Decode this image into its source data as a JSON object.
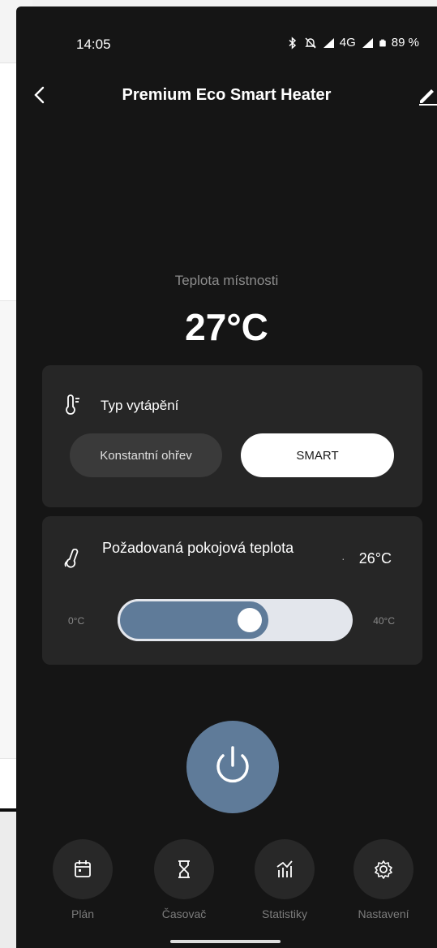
{
  "status_bar": {
    "time": "14:05",
    "network": "4G",
    "battery": "89 %"
  },
  "header": {
    "title": "Premium Eco Smart Heater",
    "back_icon": "chevron-left-icon",
    "edit_icon": "pencil-icon"
  },
  "room": {
    "label": "Teplota místnosti",
    "temperature": "27°C"
  },
  "heating_type": {
    "title": "Typ vytápění",
    "icon": "thermometer-icon",
    "options": [
      "Konstantní ohřev",
      "SMART"
    ],
    "selected": "SMART"
  },
  "target_temperature": {
    "title": "Požadovaná pokojová teplota",
    "icon": "thermometer-leaf-icon",
    "value": "26°C",
    "min_label": "0°C",
    "max_label": "40°C",
    "slider_fraction": 0.65
  },
  "power_button": {
    "icon": "power-icon",
    "color": "#5f7b99"
  },
  "bottom_nav": [
    {
      "label": "Plán",
      "icon": "calendar-icon"
    },
    {
      "label": "Časovač",
      "icon": "hourglass-icon"
    },
    {
      "label": "Statistiky",
      "icon": "chart-icon"
    },
    {
      "label": "Nastavení",
      "icon": "gear-icon"
    }
  ],
  "colors": {
    "background": "#151515",
    "card": "#262626",
    "accent": "#5f7b99"
  }
}
